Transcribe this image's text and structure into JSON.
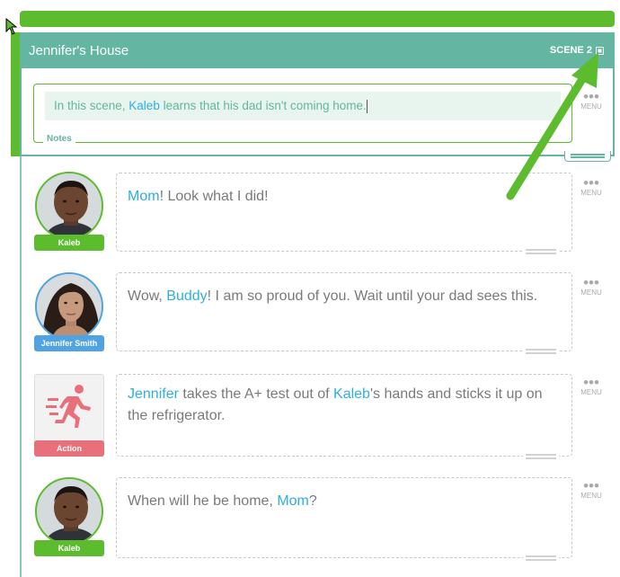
{
  "scene": {
    "title": "Jennifer's House",
    "label": "SCENE 2",
    "label_icon": "square-icon",
    "notes": {
      "prefix": "In this scene, ",
      "highlight": "Kaleb",
      "suffix": " learns that his dad isn't coming home.",
      "label": "Notes"
    }
  },
  "menu_label": "MENU",
  "rows": [
    {
      "type": "character",
      "name": "Kaleb",
      "tag_color": "#5dbb2e",
      "segments": [
        {
          "text": "Mom",
          "hl": true
        },
        {
          "text": "! Look what I did!",
          "hl": false
        }
      ]
    },
    {
      "type": "character",
      "name": "Jennifer Smith",
      "tag_color": "#4fa3e0",
      "segments": [
        {
          "text": "Wow, ",
          "hl": false
        },
        {
          "text": "Buddy",
          "hl": true
        },
        {
          "text": "! I am so proud of you. Wait until your dad sees this.",
          "hl": false
        }
      ]
    },
    {
      "type": "action",
      "name": "Action",
      "tag_color": "#e8707a",
      "icon": "running-person-icon",
      "segments": [
        {
          "text": "Jennifer",
          "hl": true
        },
        {
          "text": " takes the A+ test out of ",
          "hl": false
        },
        {
          "text": "Kaleb",
          "hl": true
        },
        {
          "text": "'s hands and sticks it up on the refrigerator.",
          "hl": false
        }
      ]
    },
    {
      "type": "character",
      "name": "Kaleb",
      "tag_color": "#5dbb2e",
      "segments": [
        {
          "text": "When will he be home, ",
          "hl": false
        },
        {
          "text": "Mom",
          "hl": true
        },
        {
          "text": "?",
          "hl": false
        }
      ]
    }
  ],
  "colors": {
    "accent_green": "#5dbb2e",
    "scene_teal": "#64b5a1",
    "highlight_blue": "#2eaee2"
  }
}
